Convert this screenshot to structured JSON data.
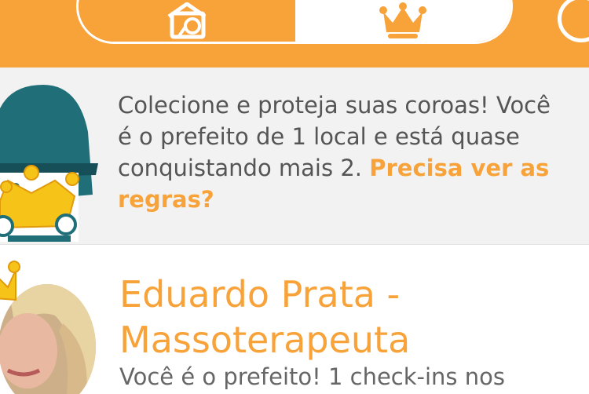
{
  "header": {
    "tabs": [
      {
        "icon": "home-icon",
        "selected": false
      },
      {
        "icon": "crown-icon",
        "selected": true
      }
    ],
    "accent_color": "#f8a23a"
  },
  "banner": {
    "text": "Colecione e proteja suas coroas! Você é o prefeito de 1 local e está quase conquistando mais 2.",
    "link": "Precisa ver as regras?"
  },
  "list": {
    "items": [
      {
        "title": "Eduardo Prata - Massoterapeuta",
        "subtitle": "Você é o prefeito! 1 check-ins nos"
      }
    ]
  }
}
